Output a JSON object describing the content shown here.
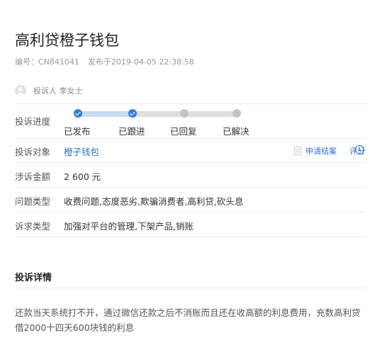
{
  "complaint": {
    "title": "高利贷橙子钱包",
    "id_text": "编号：CN841041",
    "published_text": "发布于2019-04-05 22:38:58",
    "complainant_text": "投诉人 李女士"
  },
  "progress": {
    "label": "投诉进度",
    "steps": [
      "已发布",
      "已跟进",
      "已回复",
      "已解决"
    ],
    "completed_steps": 2
  },
  "target": {
    "label": "投诉对象",
    "value": "橙子钱包",
    "apply_close": "申请结案",
    "rate": "评分"
  },
  "amount": {
    "label": "涉诉金额",
    "value": "2 600 元"
  },
  "issue_type": {
    "label": "问题类型",
    "value": "收费问题,态度恶劣,欺骗消费者,高利贷,砍头息"
  },
  "demand_type": {
    "label": "诉求类型",
    "value": "加强对平台的管理,下架产品,销账"
  },
  "details": {
    "heading": "投诉详情",
    "text": "还款当天系统打不开，通过微信还款之后不消账而且还在收高额的利息费用，充数高利贷借2000十四天600块钱的利息"
  },
  "icons": {
    "avatar": "user-avatar-icon",
    "document": "document-icon",
    "info": "info-icon",
    "check": "check-icon"
  },
  "colors": {
    "accent": "#2f7de0",
    "link": "#2f6fd0",
    "divider": "#ebebeb"
  }
}
